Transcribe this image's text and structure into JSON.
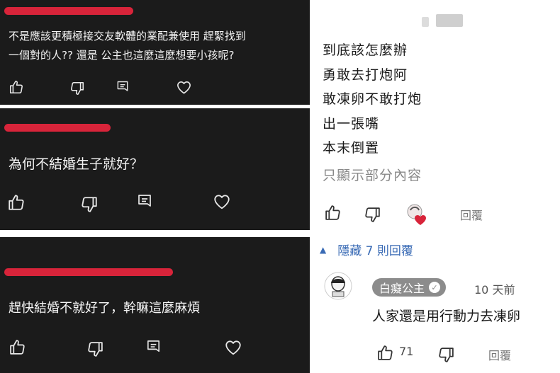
{
  "left_comments": [
    {
      "text_line1": "不是應該更積極接交友軟體的業配兼使用 趕緊找到",
      "text_line2": "一個對的人?? 還是 公主也這麼這麼想要小孩呢?",
      "actions": [
        "thumb-up-icon",
        "thumb-down-icon",
        "comment-icon",
        "heart-icon"
      ]
    },
    {
      "text": "為何不結婚生子就好？",
      "actions": [
        "thumb-up-icon",
        "thumb-down-icon",
        "comment-icon",
        "heart-icon"
      ]
    },
    {
      "text": "趕快結婚不就好了，幹嘛這麼麻煩",
      "actions": [
        "thumb-up-icon",
        "thumb-down-icon",
        "comment-icon",
        "heart-icon"
      ]
    }
  ],
  "right_thread": {
    "lines": [
      "到底該怎麼辦",
      "勇敢去打炮阿",
      "敢凍卵不敢打炮",
      "出一張嘴",
      "本末倒置"
    ],
    "show_partial": "只顯示部分內容",
    "reply_label": "回覆",
    "hide_replies": "隱藏 7 則回覆",
    "reply": {
      "author": "白癡公主",
      "time": "10 天前",
      "text": "人家還是用行動力去凍卵",
      "likes": "71",
      "reply_label": "回覆"
    }
  },
  "colors": {
    "panel_bg": "#1b1b1b",
    "redaction": "#d8243a",
    "link_blue": "#3a6bb5",
    "author_chip": "#8c8c8c"
  }
}
